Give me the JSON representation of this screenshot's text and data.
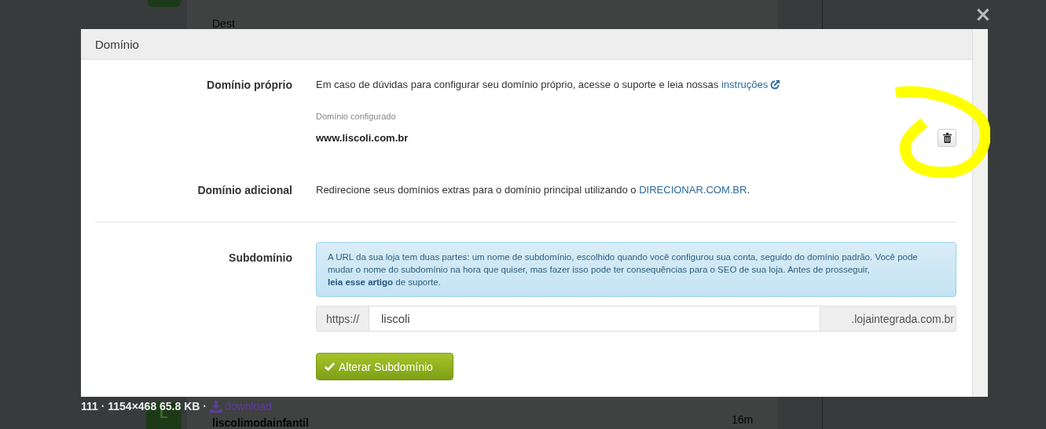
{
  "background": {
    "top_text": "Dest",
    "info": "111 · 1154×468 65.8 KB ·",
    "download_link": "download",
    "avatar_letter": "L",
    "username": "liscolimodainfantil",
    "time": "16m"
  },
  "close_button": "×",
  "modal": {
    "title": "Domínio",
    "own_domain": {
      "label": "Domínio próprio",
      "text": "Em caso de dúvidas para configurar seu domínio próprio, acesse o suporte e leia nossas",
      "link": "instruções",
      "configured_label": "Domínio configurado",
      "configured_value": "www.liscoli.com.br"
    },
    "additional_domain": {
      "label": "Domínio adicional",
      "text": "Redirecione seus domínios extras para o domínio principal utilizando o",
      "link": "DIRECIONAR.COM.BR",
      "after": "."
    },
    "subdomain": {
      "label": "Subdomínio",
      "alert": "A URL da sua loja tem duas partes: um nome de subdomínio, escolhido quando você configurou sua conta, seguido do domínio padrão. Você pode mudar o nome do subdomínio na hora que quiser, mas fazer isso pode ter consequências para o SEO de sua loja. Antes de prosseguir,",
      "alert_link": "leia esse artigo",
      "alert_after": "de suporte.",
      "prefix": "https://",
      "value": "liscoli",
      "suffix": ".lojaintegrada.com.br",
      "button": "Alterar Subdomínio"
    }
  }
}
